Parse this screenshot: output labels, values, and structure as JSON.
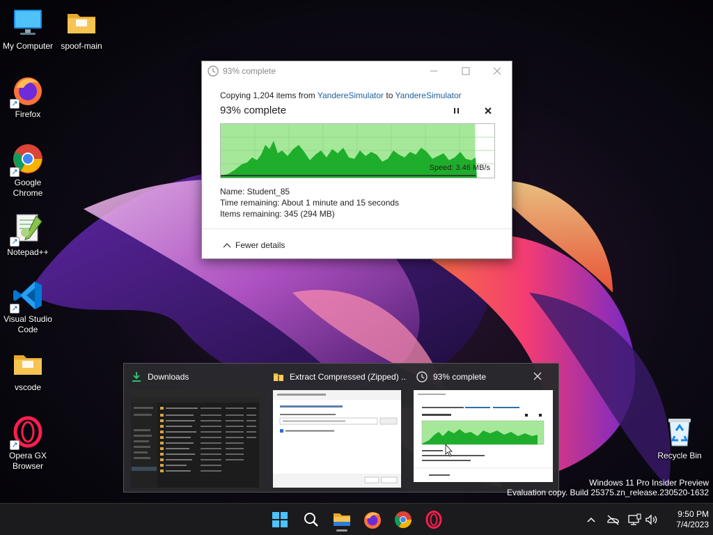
{
  "desktop": {
    "icons": [
      {
        "label": "My Computer",
        "icon": "monitor-icon"
      },
      {
        "label": "spoof-main",
        "icon": "folder-icon"
      },
      {
        "label": "Firefox",
        "icon": "firefox-icon"
      },
      {
        "label": "Google Chrome",
        "icon": "chrome-icon"
      },
      {
        "label": "Notepad++",
        "icon": "notepadpp-icon"
      },
      {
        "label": "Visual Studio Code",
        "icon": "vscode-icon"
      },
      {
        "label": "vscode",
        "icon": "folder-icon"
      },
      {
        "label": "Opera GX Browser",
        "icon": "opera-gx-icon"
      },
      {
        "label": "Recycle Bin",
        "icon": "recycle-bin-icon"
      }
    ]
  },
  "copy_dialog": {
    "title": "93% complete",
    "copying_prefix": "Copying 1,204 items from ",
    "source": "YandereSimulator",
    "to_word": " to ",
    "destination": "YandereSimulator",
    "progress_title": "93% complete",
    "progress": 0.93,
    "speed": "Speed: 3.46 MB/s",
    "name_line": "Name:  Student_85",
    "time_line": "Time remaining:  About 1 minute and 15 seconds",
    "items_line": "Items remaining:  345 (294 MB)",
    "fewer_details": "Fewer details"
  },
  "thumbnails": [
    {
      "title": "Downloads",
      "icon": "download-icon"
    },
    {
      "title": "Extract Compressed (Zipped) ...",
      "icon": "zip-folder-icon"
    },
    {
      "title": "93% complete",
      "icon": "clock-icon"
    }
  ],
  "watermark": {
    "line1": "Windows 11 Pro Insider Preview",
    "line2": "Evaluation copy. Build 25375.zn_release.230520-1632"
  },
  "taskbar": {
    "apps": [
      "start-icon",
      "search-icon",
      "file-explorer-icon",
      "firefox-icon",
      "chrome-icon",
      "opera-gx-icon"
    ],
    "tray": [
      "chevron-up-icon",
      "network-icon",
      "display-icon",
      "volume-icon"
    ]
  },
  "clock": {
    "time": "9:50 PM",
    "date": "7/4/2023"
  }
}
